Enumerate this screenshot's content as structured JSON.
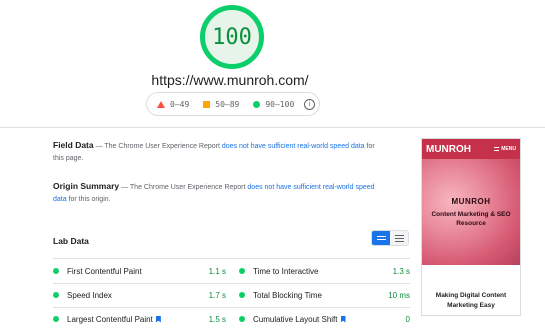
{
  "score": {
    "value": "100"
  },
  "site": {
    "url": "https://www.munroh.com/"
  },
  "legend": {
    "fail": "0–49",
    "average": "50–89",
    "pass": "90–100",
    "info_glyph": "i",
    "colors": {
      "fail": "#ff4e42",
      "average": "#ffa400",
      "pass": "#0cce6b"
    }
  },
  "field_data": {
    "title": "Field Data",
    "text_before": " — The Chrome User Experience Report ",
    "link": "does not have sufficient real-world speed data",
    "text_after": " for this page."
  },
  "origin_summary": {
    "title": "Origin Summary",
    "text_before": " — The Chrome User Experience Report ",
    "link": "does not have sufficient real-world speed data",
    "text_after": " for this origin."
  },
  "lab_data": {
    "title": "Lab Data",
    "metrics": [
      {
        "label": "First Contentful Paint",
        "value": "1.1 s"
      },
      {
        "label": "Time to Interactive",
        "value": "1.3 s"
      },
      {
        "label": "Speed Index",
        "value": "1.7 s"
      },
      {
        "label": "Total Blocking Time",
        "value": "10 ms"
      },
      {
        "label": "Largest Contentful Paint",
        "value": "1.5 s"
      },
      {
        "label": "Cumulative Layout Shift",
        "value": "0"
      }
    ]
  },
  "preview": {
    "logo": "MUNROH",
    "menu": "MENU",
    "hero_title": "MUNROH",
    "hero_subtitle": "Content Marketing & SEO Resource",
    "footer": "Making Digital Content Marketing Easy"
  }
}
